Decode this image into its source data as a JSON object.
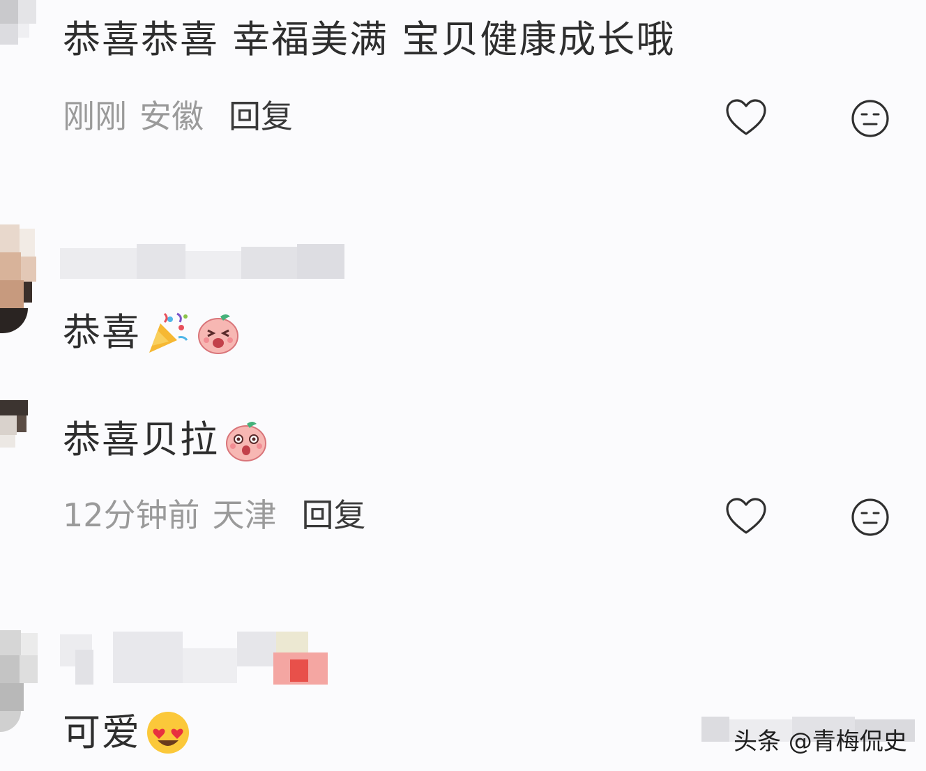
{
  "comments": [
    {
      "text": "恭喜恭喜 幸福美满 宝贝健康成长哦",
      "time": "刚刚",
      "location": "安徽",
      "reply_label": "回复"
    },
    {
      "text": "恭喜",
      "emojis": [
        "party-popper-emoji",
        "laughing-peach-emoji"
      ]
    },
    {
      "text": "恭喜贝拉",
      "emojis": [
        "surprised-peach-emoji"
      ],
      "time": "12分钟前",
      "location": "天津",
      "reply_label": "回复"
    },
    {
      "text": "可爱",
      "emojis": [
        "heart-eyes-emoji"
      ]
    }
  ],
  "icons": {
    "like": "heart-outline-icon",
    "reaction": "neutral-face-icon"
  },
  "watermark": "头条 @青梅侃史",
  "colors": {
    "background": "#fbfbfd",
    "text": "#2e2e2e",
    "meta": "#9a9a9a",
    "reply": "#3a3a3a"
  }
}
